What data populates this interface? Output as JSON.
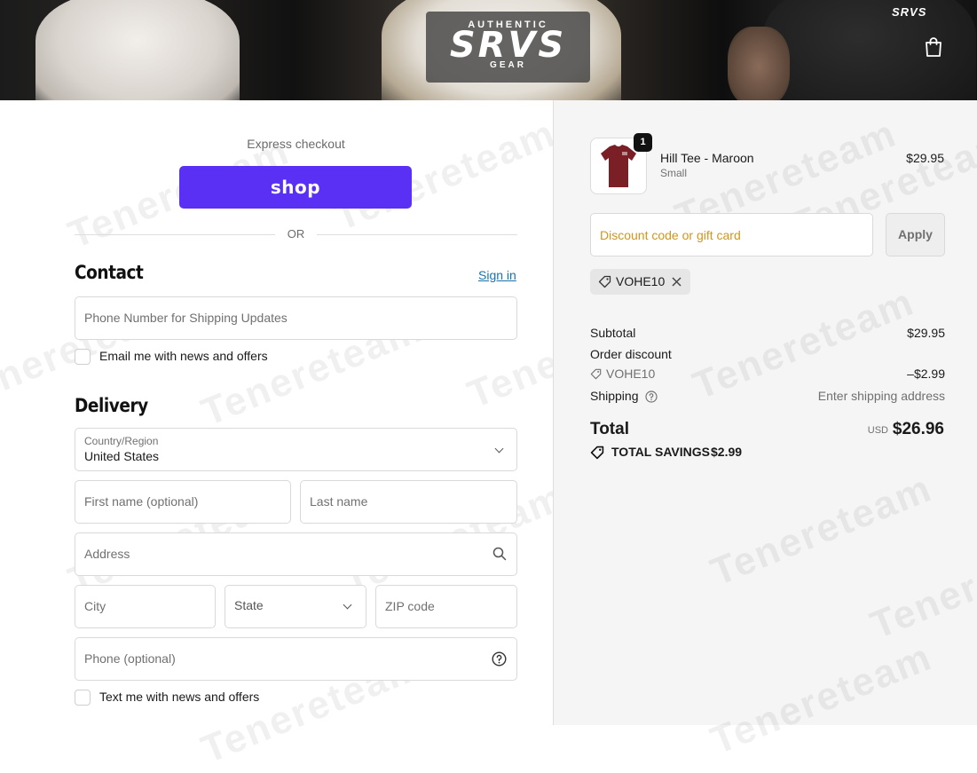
{
  "header": {
    "logo_top": "AUTHENTIC",
    "logo_main": "SRVS",
    "logo_bottom": "GEAR",
    "shirt_mark": "SRVS",
    "cart_icon": "shopping-bag-icon"
  },
  "express": {
    "label": "Express checkout",
    "shop_label": "shop",
    "or_label": "OR"
  },
  "contact": {
    "title": "Contact",
    "sign_in": "Sign in",
    "phone_placeholder": "Phone Number for Shipping Updates",
    "email_optin": "Email me with news and offers"
  },
  "delivery": {
    "title": "Delivery",
    "country_label": "Country/Region",
    "country_value": "United States",
    "first_name_placeholder": "First name (optional)",
    "last_name_placeholder": "Last name",
    "address_placeholder": "Address",
    "city_placeholder": "City",
    "state_placeholder": "State",
    "zip_placeholder": "ZIP code",
    "phone_placeholder": "Phone (optional)",
    "text_optin": "Text me with news and offers"
  },
  "order": {
    "item": {
      "name": "Hill Tee - Maroon",
      "variant": "Small",
      "price": "$29.95",
      "quantity": "1",
      "color": "#7a1f26"
    },
    "discount_placeholder": "Discount code or gift card",
    "apply_label": "Apply",
    "applied_code": "VOHE10",
    "subtotal_label": "Subtotal",
    "subtotal_value": "$29.95",
    "order_discount_label": "Order discount",
    "discount_code": "VOHE10",
    "discount_value": "–$2.99",
    "shipping_label": "Shipping",
    "shipping_value": "Enter shipping address",
    "total_label": "Total",
    "currency": "USD",
    "total_value": "$26.96",
    "savings_label": "TOTAL SAVINGS",
    "savings_value": "$2.99"
  },
  "watermark": "Tenereteam",
  "colors": {
    "shop_pay": "#5a31f4",
    "link": "#1773b0",
    "discount_placeholder": "#d1961c"
  }
}
